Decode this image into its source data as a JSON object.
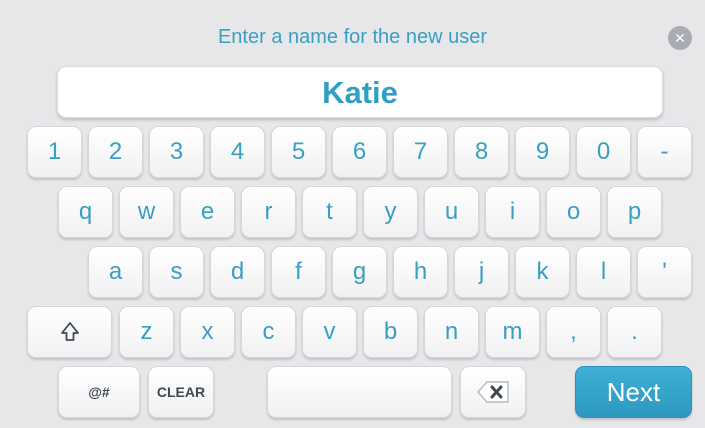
{
  "prompt": "Enter a name for the new user",
  "close_icon": "close-icon",
  "input": {
    "value": "Katie"
  },
  "keyboard": {
    "row1": [
      "1",
      "2",
      "3",
      "4",
      "5",
      "6",
      "7",
      "8",
      "9",
      "0",
      "-"
    ],
    "row2": [
      "q",
      "w",
      "e",
      "r",
      "t",
      "y",
      "u",
      "i",
      "o",
      "p"
    ],
    "row3": [
      "a",
      "s",
      "d",
      "f",
      "g",
      "h",
      "j",
      "k",
      "l",
      "'"
    ],
    "row4": [
      "z",
      "x",
      "c",
      "v",
      "b",
      "n",
      "m",
      ",",
      "."
    ],
    "symbols_label": "@#",
    "clear_label": "CLEAR",
    "next_label": "Next",
    "shift_icon": "shift-icon",
    "backspace_icon": "backspace-icon"
  },
  "colors": {
    "accent": "#3a9fc0",
    "background": "#e7e7e9",
    "next_button": "#2f9fc4"
  }
}
